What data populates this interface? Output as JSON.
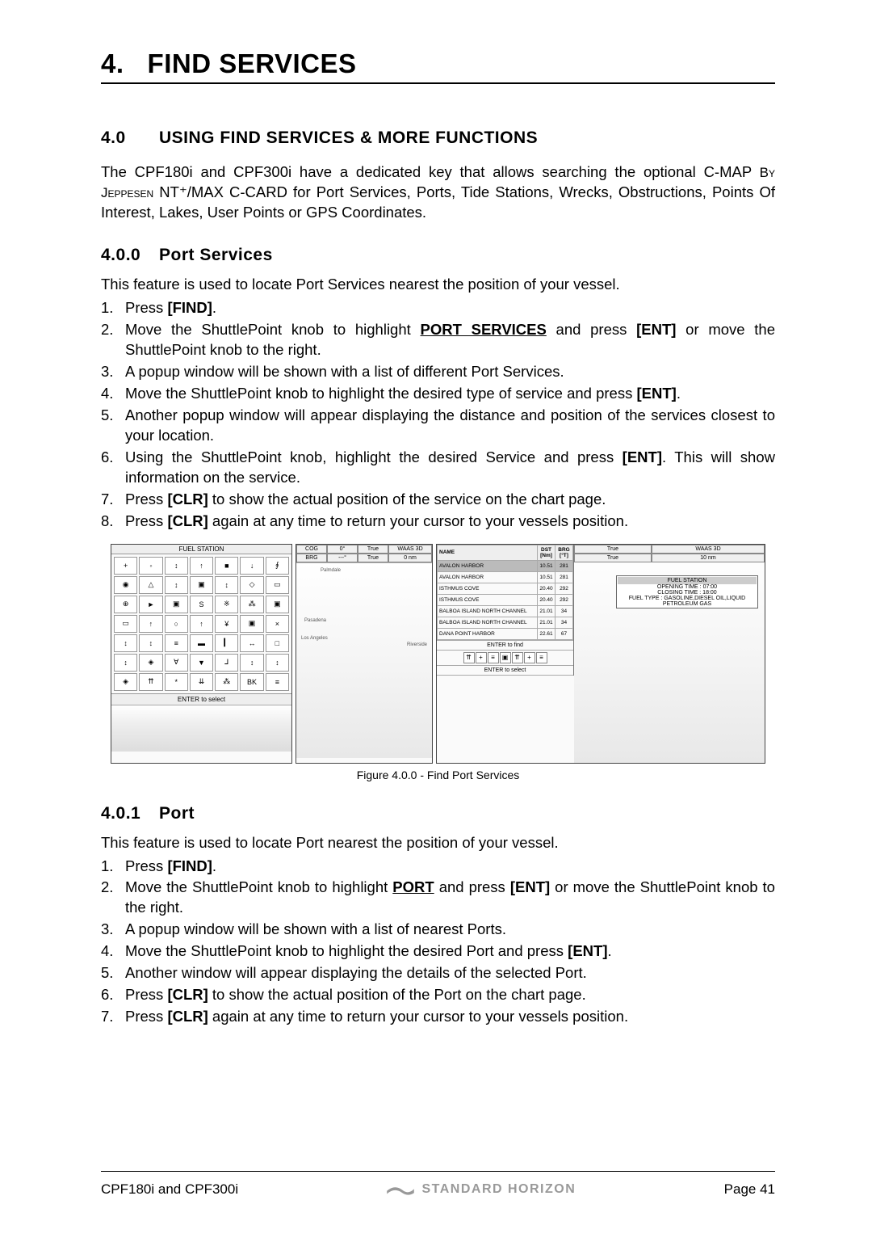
{
  "chapter": {
    "num": "4.",
    "title": "FIND SERVICES"
  },
  "section40": {
    "num": "4.0",
    "title": "USING FIND SERVICES & MORE FUNCTIONS",
    "par1a": "The CPF180i and CPF300i have a dedicated key that allows searching the optional C-MAP",
    "par1b_sc": "By Jeppesen",
    "par1b_rest": " NT⁺/MAX C-CARD for Port Services, Ports, Tide Stations, Wrecks, Obstructions, Points Of Interest, Lakes, User Points or GPS Coordinates."
  },
  "subsection400": {
    "num": "4.0.0",
    "title": "Port Services",
    "intro": "This feature is used to locate Port Services nearest the position of your vessel.",
    "steps": [
      [
        "Press ",
        "[FIND]",
        "."
      ],
      [
        "Move the ShuttlePoint knob to highlight ",
        "_PORT SERVICES_",
        " and press ",
        "[ENT]",
        " or move the ShuttlePoint knob to the right."
      ],
      [
        "A popup window will be shown with a list of different Port Services."
      ],
      [
        "Move the ShuttlePoint knob to highlight the desired type of service and press ",
        "[ENT]",
        "."
      ],
      [
        "Another popup window will appear displaying the distance and position of the services closest to your location."
      ],
      [
        "Using the ShuttlePoint knob, highlight the desired Service and press ",
        "[ENT]",
        ". This will show information on the service."
      ],
      [
        "Press ",
        "[CLR]",
        " to show the actual position of the service on the chart page."
      ],
      [
        "Press ",
        "[CLR]",
        " again at any time to return your cursor to your vessels position."
      ]
    ]
  },
  "figure": {
    "caption": "Figure 4.0.0 - Find Port Services",
    "p1_header": "FUEL STATION",
    "p1_footer": "ENTER to select",
    "icons": [
      "+",
      "◦",
      "↕",
      "↑",
      "■",
      "↓",
      "∮",
      "◉",
      "△",
      "↕",
      "▣",
      "↕",
      "◇",
      "▭",
      "⊕",
      "►",
      "▣",
      "S",
      "※",
      "⁂",
      "▣",
      "▭",
      "↑",
      "○",
      "↑",
      "¥",
      "▣",
      "×",
      "↕",
      "↕",
      "≡",
      "▬",
      "▎",
      "↔",
      "□",
      "↕",
      "◈",
      "∀",
      "▼",
      "⅃",
      "↕",
      "↕",
      "◈",
      "⇈",
      "*",
      "⇊",
      "⁂",
      "BK",
      "≡",
      "↑",
      "⇈",
      "≡",
      "≡",
      "▣",
      "⇈",
      "≡",
      "⇈"
    ],
    "p2_h": {
      "cog": "COG",
      "deg": "0°",
      "true1": "True",
      "waas": "WAAS 3D",
      "brg": "BRG",
      "dash": "---°",
      "true2": "True",
      "sub": "0 nm"
    },
    "p2_labels": {
      "a": "Palmdale",
      "b": "Pasadena",
      "c": "Los Angeles",
      "d": "Riverside"
    },
    "p3_table_h": [
      "NAME",
      "DST [Nm]",
      "BRG [°T]"
    ],
    "p3_rows": [
      [
        "AVALON HARBOR",
        "10.51",
        "281"
      ],
      [
        "AVALON HARBOR",
        "10.51",
        "281"
      ],
      [
        "ISTHMUS COVE",
        "20.40",
        "292"
      ],
      [
        "ISTHMUS COVE",
        "20.40",
        "292"
      ],
      [
        "BALBOA ISLAND NORTH CHANNEL",
        "21.01",
        "34"
      ],
      [
        "BALBOA ISLAND NORTH CHANNEL",
        "21.01",
        "34"
      ],
      [
        "DANA POINT HARBOR",
        "22.61",
        "67"
      ]
    ],
    "p3_mid1": "ENTER to find",
    "p3_mid2": "ENTER to select",
    "p3_r_h": {
      "true1": "True",
      "waas": "WAAS 3D",
      "true2": "True",
      "sub": "10 nm"
    },
    "p3_info": {
      "hdr": "FUEL STATION",
      "l1": "OPENING TIME : 07:00",
      "l2": "CLOSING TIME : 18:00",
      "l3": "FUEL TYPE : GASOLINE,DIESEL OIL,LIQUID PETROLEUM GAS"
    }
  },
  "subsection401": {
    "num": "4.0.1",
    "title": "Port",
    "intro": "This feature is used to locate Port nearest the position of your vessel.",
    "steps": [
      [
        "Press ",
        "[FIND]",
        "."
      ],
      [
        "Move the ShuttlePoint knob to highlight ",
        "_PORT_",
        " and press ",
        "[ENT]",
        " or move the Shuttle­Point knob to the right."
      ],
      [
        "A popup window will be shown with a list of nearest Ports."
      ],
      [
        "Move the ShuttlePoint knob to highlight the desired Port and press ",
        "[ENT]",
        "."
      ],
      [
        "Another window will appear displaying the details of the selected Port."
      ],
      [
        "Press ",
        "[CLR]",
        " to show the actual position of the Port on the chart page."
      ],
      [
        "Press ",
        "[CLR]",
        " again at any time to return your cursor to your vessels position."
      ]
    ]
  },
  "footer": {
    "left": "CPF180i and CPF300i",
    "logo": "STANDARD HORIZON",
    "right": "Page 41"
  }
}
